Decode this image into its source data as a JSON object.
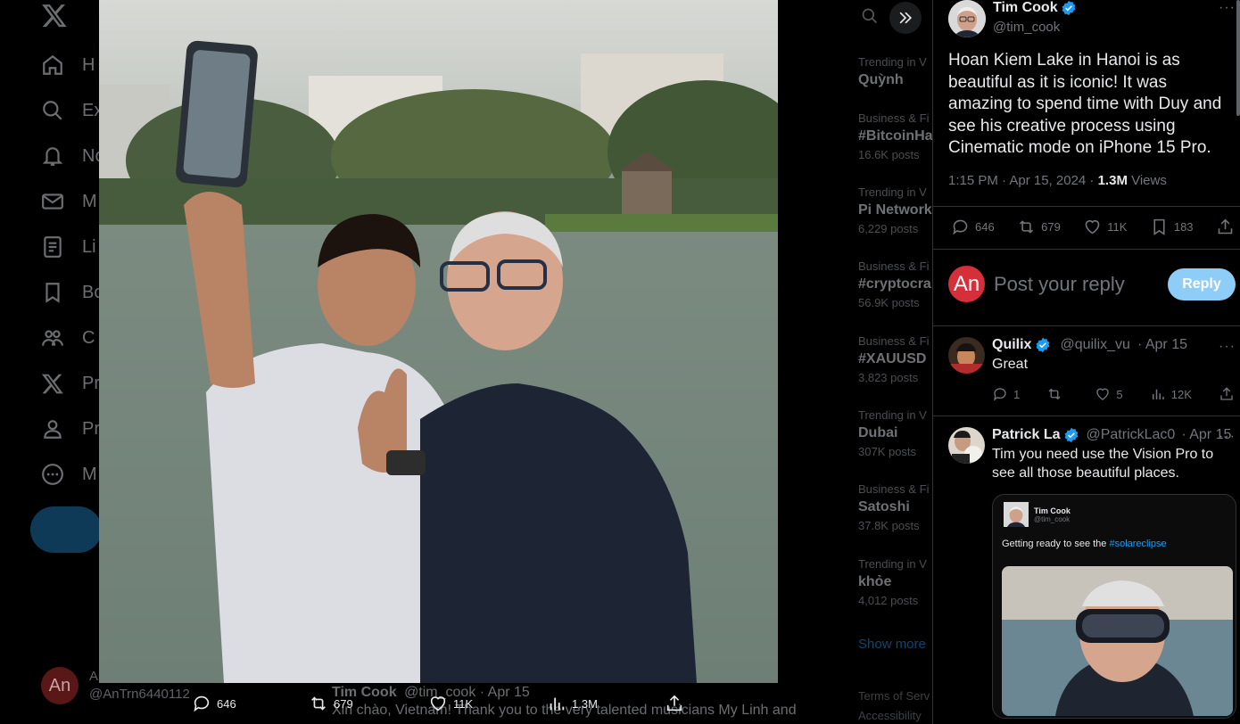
{
  "left_nav": {
    "items": [
      {
        "label": "H",
        "icon": "home-icon"
      },
      {
        "label": "Ex",
        "icon": "search-icon"
      },
      {
        "label": "No",
        "icon": "bell-icon"
      },
      {
        "label": "M",
        "icon": "mail-icon"
      },
      {
        "label": "Li",
        "icon": "list-icon"
      },
      {
        "label": "Bo",
        "icon": "bookmark-icon"
      },
      {
        "label": "C",
        "icon": "communities-icon"
      },
      {
        "label": "Pr",
        "icon": "x-premium-icon"
      },
      {
        "label": "Pr",
        "icon": "profile-icon"
      },
      {
        "label": "M",
        "icon": "more-icon"
      }
    ],
    "account": {
      "avatar": "An",
      "name": "A",
      "handle": "@AnTrn6440112"
    }
  },
  "trends": [
    {
      "category": "Trending in V",
      "title": "Quỳnh",
      "posts": ""
    },
    {
      "category": "Business & Fi",
      "title": "#BitcoinHa",
      "posts": "16.6K posts"
    },
    {
      "category": "Trending in V",
      "title": "Pi Network",
      "posts": "6,229 posts"
    },
    {
      "category": "Business & Fi",
      "title": "#cryptocra",
      "posts": "56.9K posts"
    },
    {
      "category": "Business & Fi",
      "title": "#XAUUSD",
      "posts": "3,823 posts"
    },
    {
      "category": "Trending in V",
      "title": "Dubai",
      "posts": "307K posts"
    },
    {
      "category": "Business & Fi",
      "title": "Satoshi",
      "posts": "37.8K posts"
    },
    {
      "category": "Trending in V",
      "title": "khỏe",
      "posts": "4,012 posts"
    }
  ],
  "show_more": "Show more",
  "footer": {
    "line1": "Terms of Serv",
    "line2": "Accessibility"
  },
  "photo_bar": {
    "replies": "646",
    "reposts": "679",
    "likes": "11K",
    "views": "1.3M"
  },
  "peek": {
    "name": "Tim Cook",
    "handle": "@tim_cook · Apr 15",
    "text": "Xin chào, Vietnam! Thank you to the very talented musicians My Linh and"
  },
  "tweet": {
    "author": "Tim Cook",
    "handle": "@tim_cook",
    "text": "Hoan Kiem Lake in Hanoi is as beautiful as it is iconic! It was amazing to spend time with Duy and see his creative process using Cinematic mode on iPhone 15 Pro.",
    "time": "1:15 PM · Apr 15, 2024 · ",
    "views_count": "1.3M",
    "views_label": " Views",
    "replies": "646",
    "reposts": "679",
    "likes": "11K",
    "bookmarks": "183"
  },
  "reply_box": {
    "avatar": "An",
    "placeholder": "Post your reply",
    "button": "Reply"
  },
  "replies": [
    {
      "name": "Quilix",
      "handle": "@quilix_vu",
      "date": "· Apr 15",
      "text": "Great",
      "replies": "1",
      "reposts": "",
      "likes": "5",
      "views": "12K"
    },
    {
      "name": "Patrick La",
      "handle": "@PatrickLac0",
      "date": "· Apr 15",
      "text": "Tim you need use the Vision Pro to see all those beautiful places.",
      "embed": {
        "name": "Tim Cook",
        "handle": "@tim_cook",
        "text_prefix": "Getting ready to see the ",
        "hashtag": "#solareclipse"
      }
    }
  ],
  "colors": {
    "accent": "#1d9bf0",
    "reply_button": "#8ecdf8",
    "avatar_an": "#d52f3a",
    "muted": "#71767b"
  }
}
